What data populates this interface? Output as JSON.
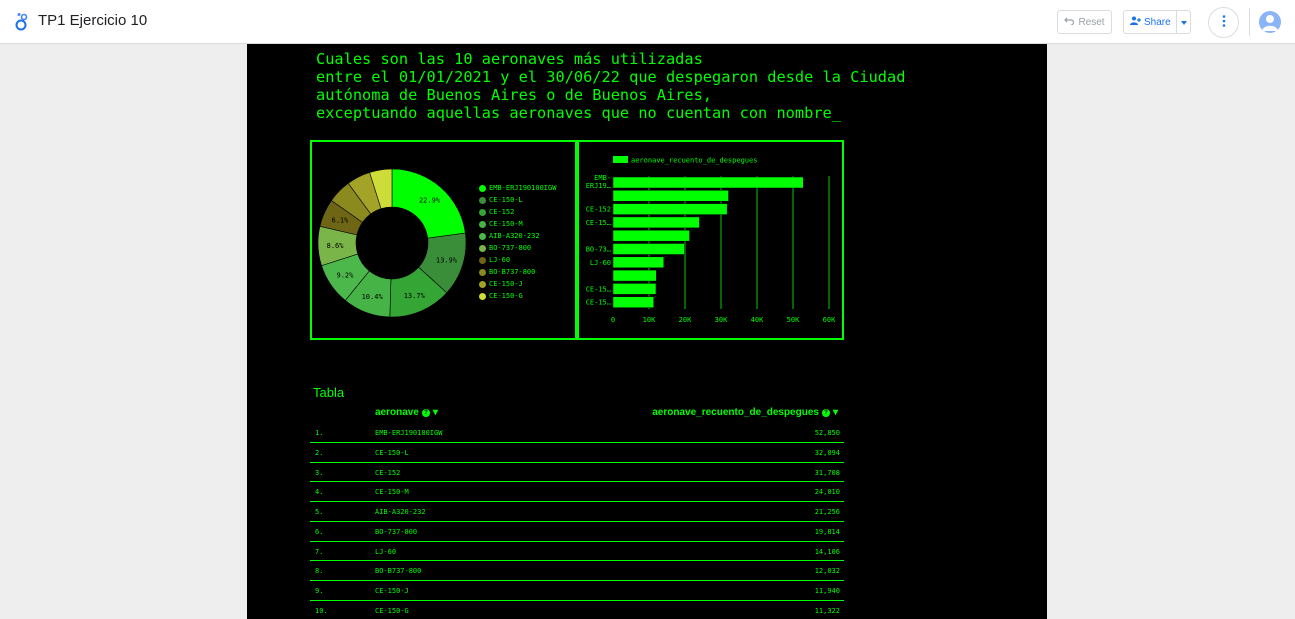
{
  "header": {
    "title": "TP1 Ejercicio 10",
    "reset_label": "Reset",
    "share_label": "Share"
  },
  "report": {
    "heading": [
      "Cuales son las 10 aeronaves más utilizadas",
      "entre el 01/01/2021 y el 30/06/22 que despegaron desde la Ciudad",
      "autónoma de Buenos Aires o de Buenos Aires,",
      "exceptuando aquellas aeronaves que no cuentan con nombre_"
    ],
    "accent_color": "#00ff00",
    "background_color": "#000000"
  },
  "chart_data": [
    {
      "type": "pie",
      "style": "donut",
      "categories": [
        "EMB-ERJ190100IGW",
        "CE-150-L",
        "CE-152",
        "CE-150-M",
        "AIB-A320-232",
        "BO-737-800",
        "LJ-60",
        "BO-B737-800",
        "CE-150-J",
        "CE-150-G"
      ],
      "values": [
        52850,
        32094,
        31708,
        24010,
        21256,
        19814,
        14106,
        12032,
        11940,
        11322
      ],
      "percent_labels": [
        "22.9%",
        "13.9%",
        "13.7%",
        "10.4%",
        "9.2%",
        "8.6%",
        "6.1%",
        "",
        "",
        ""
      ],
      "colors": [
        "#00ff00",
        "#3a8e3a",
        "#35a635",
        "#45b345",
        "#4cb84c",
        "#7ab54a",
        "#6e6614",
        "#8a8a1e",
        "#a3a327",
        "#cddc39"
      ],
      "legend": "right"
    },
    {
      "type": "bar",
      "orientation": "horizontal",
      "series": [
        {
          "name": "aeronave_recuento_de_despegues",
          "values": [
            52850,
            32094,
            31708,
            24010,
            21256,
            19814,
            14106,
            12032,
            11940,
            11322
          ]
        }
      ],
      "category_tick_labels": [
        "EMB-ERJ19…",
        "",
        "CE-152",
        "CE-15…",
        "",
        "BO-73…",
        "LJ-60",
        "",
        "CE-15…",
        "CE-15…"
      ],
      "x_ticks": [
        "0",
        "10K",
        "20K",
        "30K",
        "40K",
        "50K",
        "60K"
      ],
      "xlim": [
        0,
        60000
      ],
      "grid": true,
      "legend": "top",
      "color": "#00ff00"
    }
  ],
  "table": {
    "title": "Tabla",
    "col_aeronave": "aeronave",
    "col_count": "aeronave_recuento_de_despegues",
    "rows": [
      {
        "idx": "1.",
        "name": "EMB-ERJ190100IGW",
        "value": "52,850"
      },
      {
        "idx": "2.",
        "name": "CE-150-L",
        "value": "32,094"
      },
      {
        "idx": "3.",
        "name": "CE-152",
        "value": "31,708"
      },
      {
        "idx": "4.",
        "name": "CE-150-M",
        "value": "24,010"
      },
      {
        "idx": "5.",
        "name": "AIB-A320-232",
        "value": "21,256"
      },
      {
        "idx": "6.",
        "name": "BO-737-800",
        "value": "19,814"
      },
      {
        "idx": "7.",
        "name": "LJ-60",
        "value": "14,106"
      },
      {
        "idx": "8.",
        "name": "BO-B737-800",
        "value": "12,032"
      },
      {
        "idx": "9.",
        "name": "CE-150-J",
        "value": "11,940"
      },
      {
        "idx": "10.",
        "name": "CE-150-G",
        "value": "11,322"
      }
    ]
  }
}
